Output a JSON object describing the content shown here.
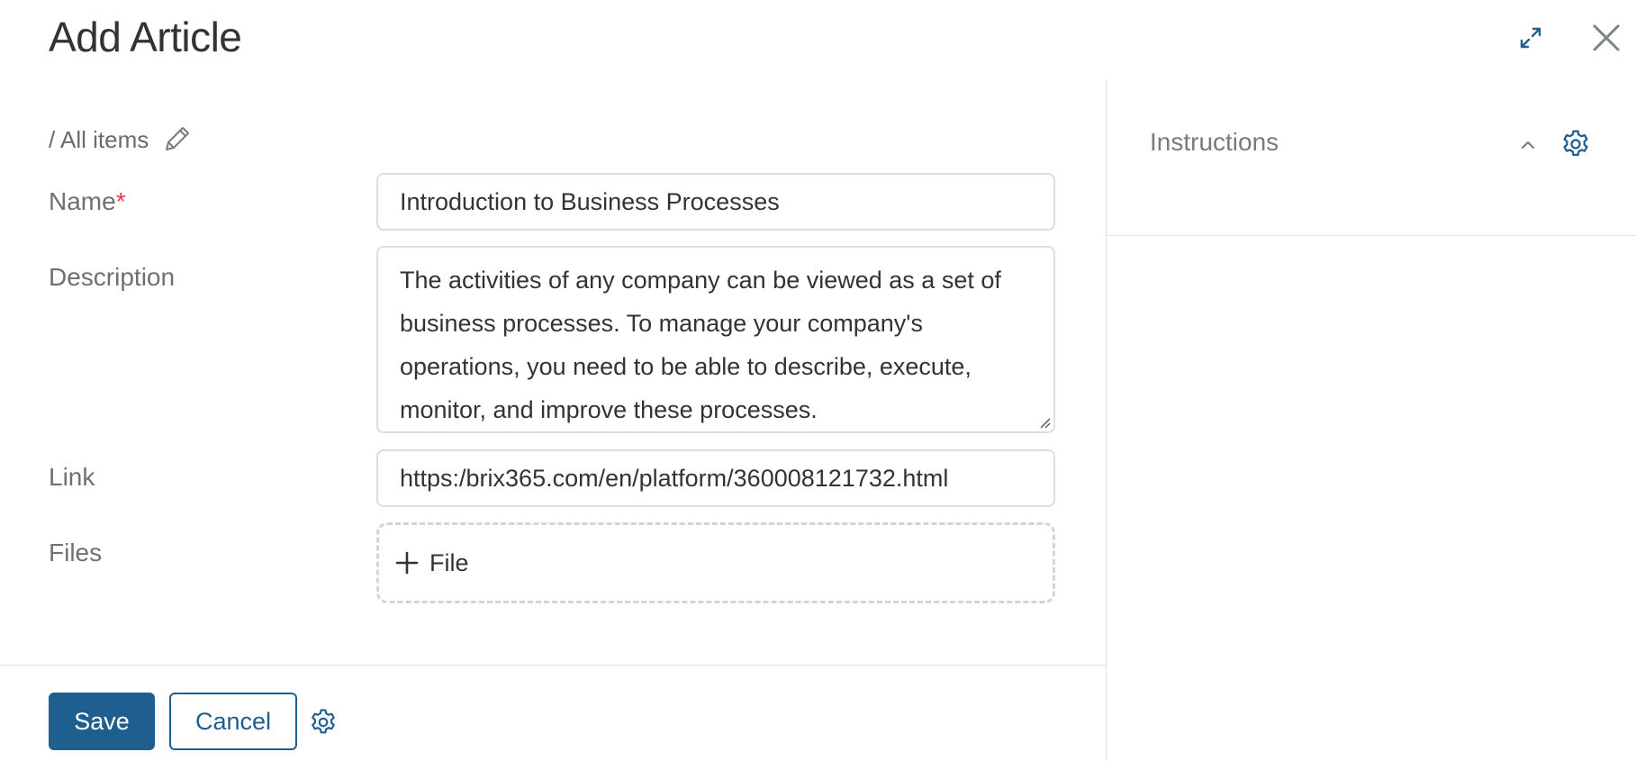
{
  "header": {
    "title": "Add Article"
  },
  "breadcrumb": {
    "text": "/ All items"
  },
  "form": {
    "name_label": "Name",
    "required_mark": "*",
    "name_value": "Introduction to Business Processes",
    "description_label": "Description",
    "description_value": "The activities of any company can be viewed as a set of business processes. To manage your company's operations, you need to be able to describe, execute, monitor, and improve these processes.",
    "link_label": "Link",
    "link_value": "https:/brix365.com/en/platform/360008121732.html",
    "files_label": "Files",
    "add_file_label": "File"
  },
  "footer": {
    "save_label": "Save",
    "cancel_label": "Cancel"
  },
  "right_panel": {
    "instructions_label": "Instructions"
  },
  "icons": {
    "expand": "expand-icon",
    "close": "close-icon",
    "edit": "pencil-icon",
    "add": "plus-icon",
    "settings": "gear-icon",
    "collapse": "chevron-up-icon"
  },
  "colors": {
    "accent": "#1e5f90",
    "required": "#e63946",
    "border": "#dcdfe2"
  }
}
